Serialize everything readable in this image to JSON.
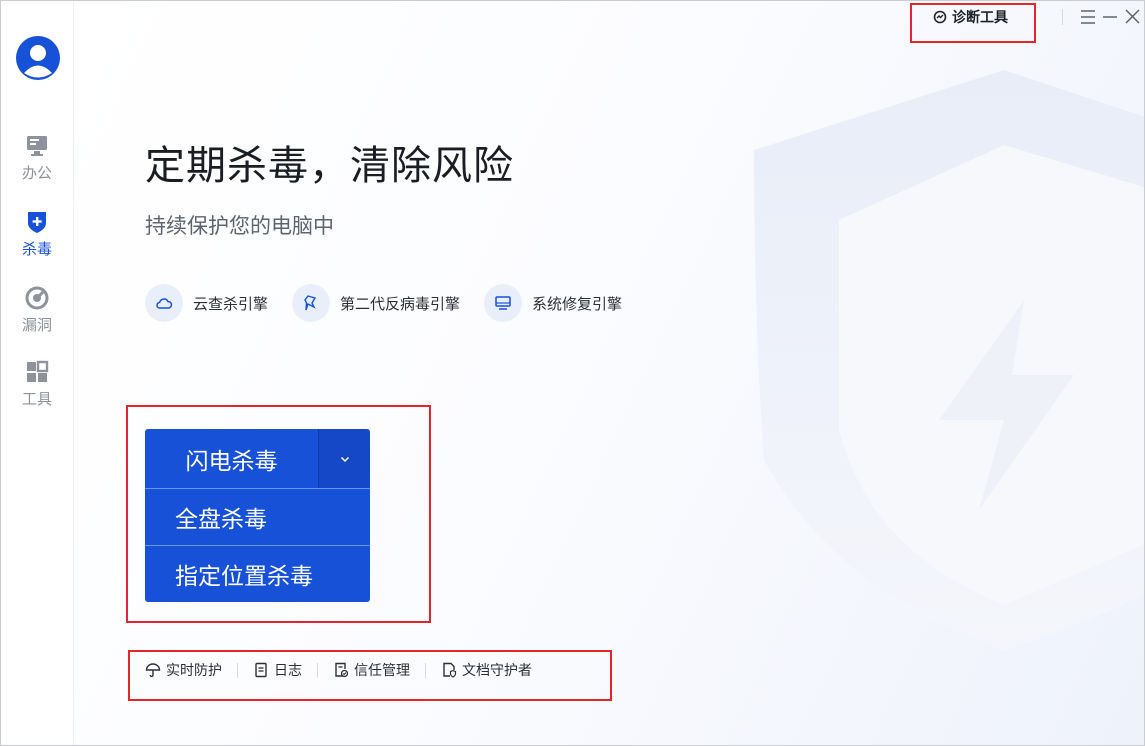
{
  "sidebar": {
    "items": [
      {
        "label": "办公",
        "icon": "monitor-icon"
      },
      {
        "label": "杀毒",
        "icon": "shield-plus-icon",
        "active": true
      },
      {
        "label": "漏洞",
        "icon": "radar-icon"
      },
      {
        "label": "工具",
        "icon": "grid-icon"
      }
    ]
  },
  "topbar": {
    "diagnostic_label": "诊断工具"
  },
  "hero": {
    "title": "定期杀毒，清除风险",
    "subtitle": "持续保护您的电脑中"
  },
  "engines": [
    {
      "label": "云查杀引擎",
      "icon": "cloud-icon"
    },
    {
      "label": "第二代反病毒引擎",
      "icon": "pin-icon"
    },
    {
      "label": "系统修复引擎",
      "icon": "monitor-icon"
    }
  ],
  "scan": {
    "main_label": "闪电杀毒",
    "menu": [
      "全盘杀毒",
      "指定位置杀毒"
    ]
  },
  "links": [
    {
      "label": "实时防护",
      "icon": "umbrella-icon"
    },
    {
      "label": "日志",
      "icon": "document-icon"
    },
    {
      "label": "信任管理",
      "icon": "trust-icon"
    },
    {
      "label": "文档守护者",
      "icon": "file-guard-icon"
    }
  ],
  "colors": {
    "accent": "#1751d8",
    "highlight": "#e3262b"
  }
}
